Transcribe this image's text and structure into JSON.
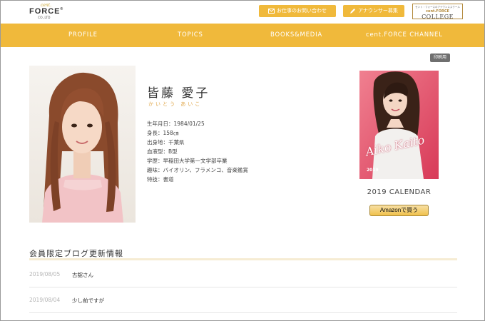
{
  "header": {
    "logo": {
      "cent": "cent.",
      "force": "FORCE",
      "suffix": "®",
      "co": "CO.,LTD"
    },
    "contact_label": "お仕事のお問い合わせ",
    "audition_label": "アナウンサー募集",
    "college": {
      "small": "セント・フォースのアナウンススクール",
      "force": "cent.FORCE",
      "college": "COLLEGE"
    }
  },
  "nav": {
    "items": [
      {
        "label": "PROFILE"
      },
      {
        "label": "TOPICS"
      },
      {
        "label": "BOOKS&MEDIA"
      },
      {
        "label": "cent.FORCE CHANNEL"
      }
    ]
  },
  "print_label": "印刷用",
  "profile": {
    "name": "皆藤 愛子",
    "kana": "かいとう あいこ",
    "details": [
      "生年月日：1984/01/25",
      "身長：158㎝",
      "出身地：千葉県",
      "血液型：B型",
      "学歴：早稲田大学第一文学部卒業",
      "趣味：バイオリン、フラメンコ、音楽鑑賞",
      "特技：書道"
    ]
  },
  "calendar": {
    "title": "2019 CALENDAR",
    "cover_script": "Aiko Kaito",
    "cover_year": "2019",
    "amazon_label": "Amazonで買う"
  },
  "blog": {
    "title": "会員限定ブログ更新情報",
    "entries": [
      {
        "date": "2019/08/05",
        "title": "古舘さん"
      },
      {
        "date": "2019/08/04",
        "title": "少し前ですが"
      }
    ]
  },
  "colors": {
    "accent": "#f0b93b",
    "kana": "#e0a74a",
    "print": "#6f6f6f"
  },
  "icons": {
    "contact": "mail-icon",
    "audition": "pen-icon"
  }
}
